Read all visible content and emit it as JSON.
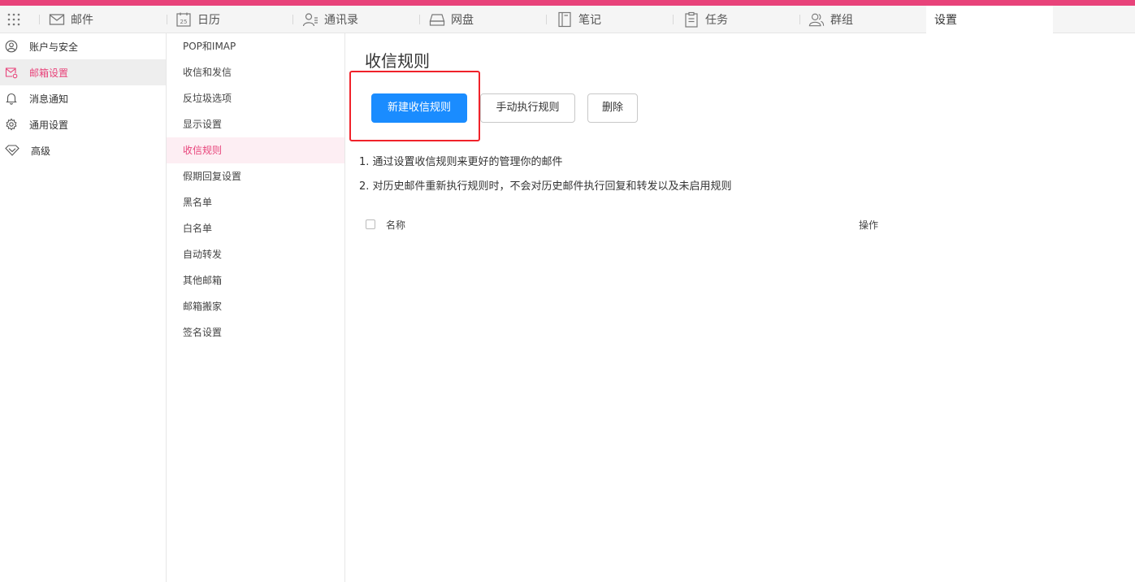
{
  "colors": {
    "brand": "#e8437a",
    "primary": "#1a8cff",
    "highlight": "#f0222a"
  },
  "topnav": {
    "items": [
      {
        "label": "邮件",
        "icon": "mail-icon"
      },
      {
        "label": "日历",
        "icon": "calendar-icon",
        "icon_text": "25"
      },
      {
        "label": "通讯录",
        "icon": "contacts-icon"
      },
      {
        "label": "网盘",
        "icon": "drive-icon"
      },
      {
        "label": "笔记",
        "icon": "notes-icon"
      },
      {
        "label": "任务",
        "icon": "tasks-icon"
      },
      {
        "label": "群组",
        "icon": "group-icon"
      },
      {
        "label": "设置",
        "active": true
      }
    ]
  },
  "sidebar": {
    "items": [
      {
        "label": "账户与安全",
        "icon": "user-circle-icon"
      },
      {
        "label": "邮箱设置",
        "icon": "mail-settings-icon",
        "active": true
      },
      {
        "label": "消息通知",
        "icon": "bell-icon"
      },
      {
        "label": "通用设置",
        "icon": "gear-icon"
      },
      {
        "label": "高级",
        "icon": "diamond-icon"
      }
    ]
  },
  "subnav": {
    "items": [
      {
        "label": "POP和IMAP"
      },
      {
        "label": "收信和发信"
      },
      {
        "label": "反垃圾选项"
      },
      {
        "label": "显示设置"
      },
      {
        "label": "收信规则",
        "active": true
      },
      {
        "label": "假期回复设置"
      },
      {
        "label": "黑名单"
      },
      {
        "label": "白名单"
      },
      {
        "label": "自动转发"
      },
      {
        "label": "其他邮箱"
      },
      {
        "label": "邮箱搬家"
      },
      {
        "label": "签名设置"
      }
    ]
  },
  "main": {
    "title": "收信规则",
    "new_rule_button": "新建收信规则",
    "run_rules_button": "手动执行规则",
    "delete_button": "删除",
    "notes": [
      "1. 通过设置收信规则来更好的管理你的邮件",
      "2. 对历史邮件重新执行规则时，不会对历史邮件执行回复和转发以及未启用规则"
    ],
    "table": {
      "col_name": "名称",
      "col_ops": "操作"
    }
  }
}
